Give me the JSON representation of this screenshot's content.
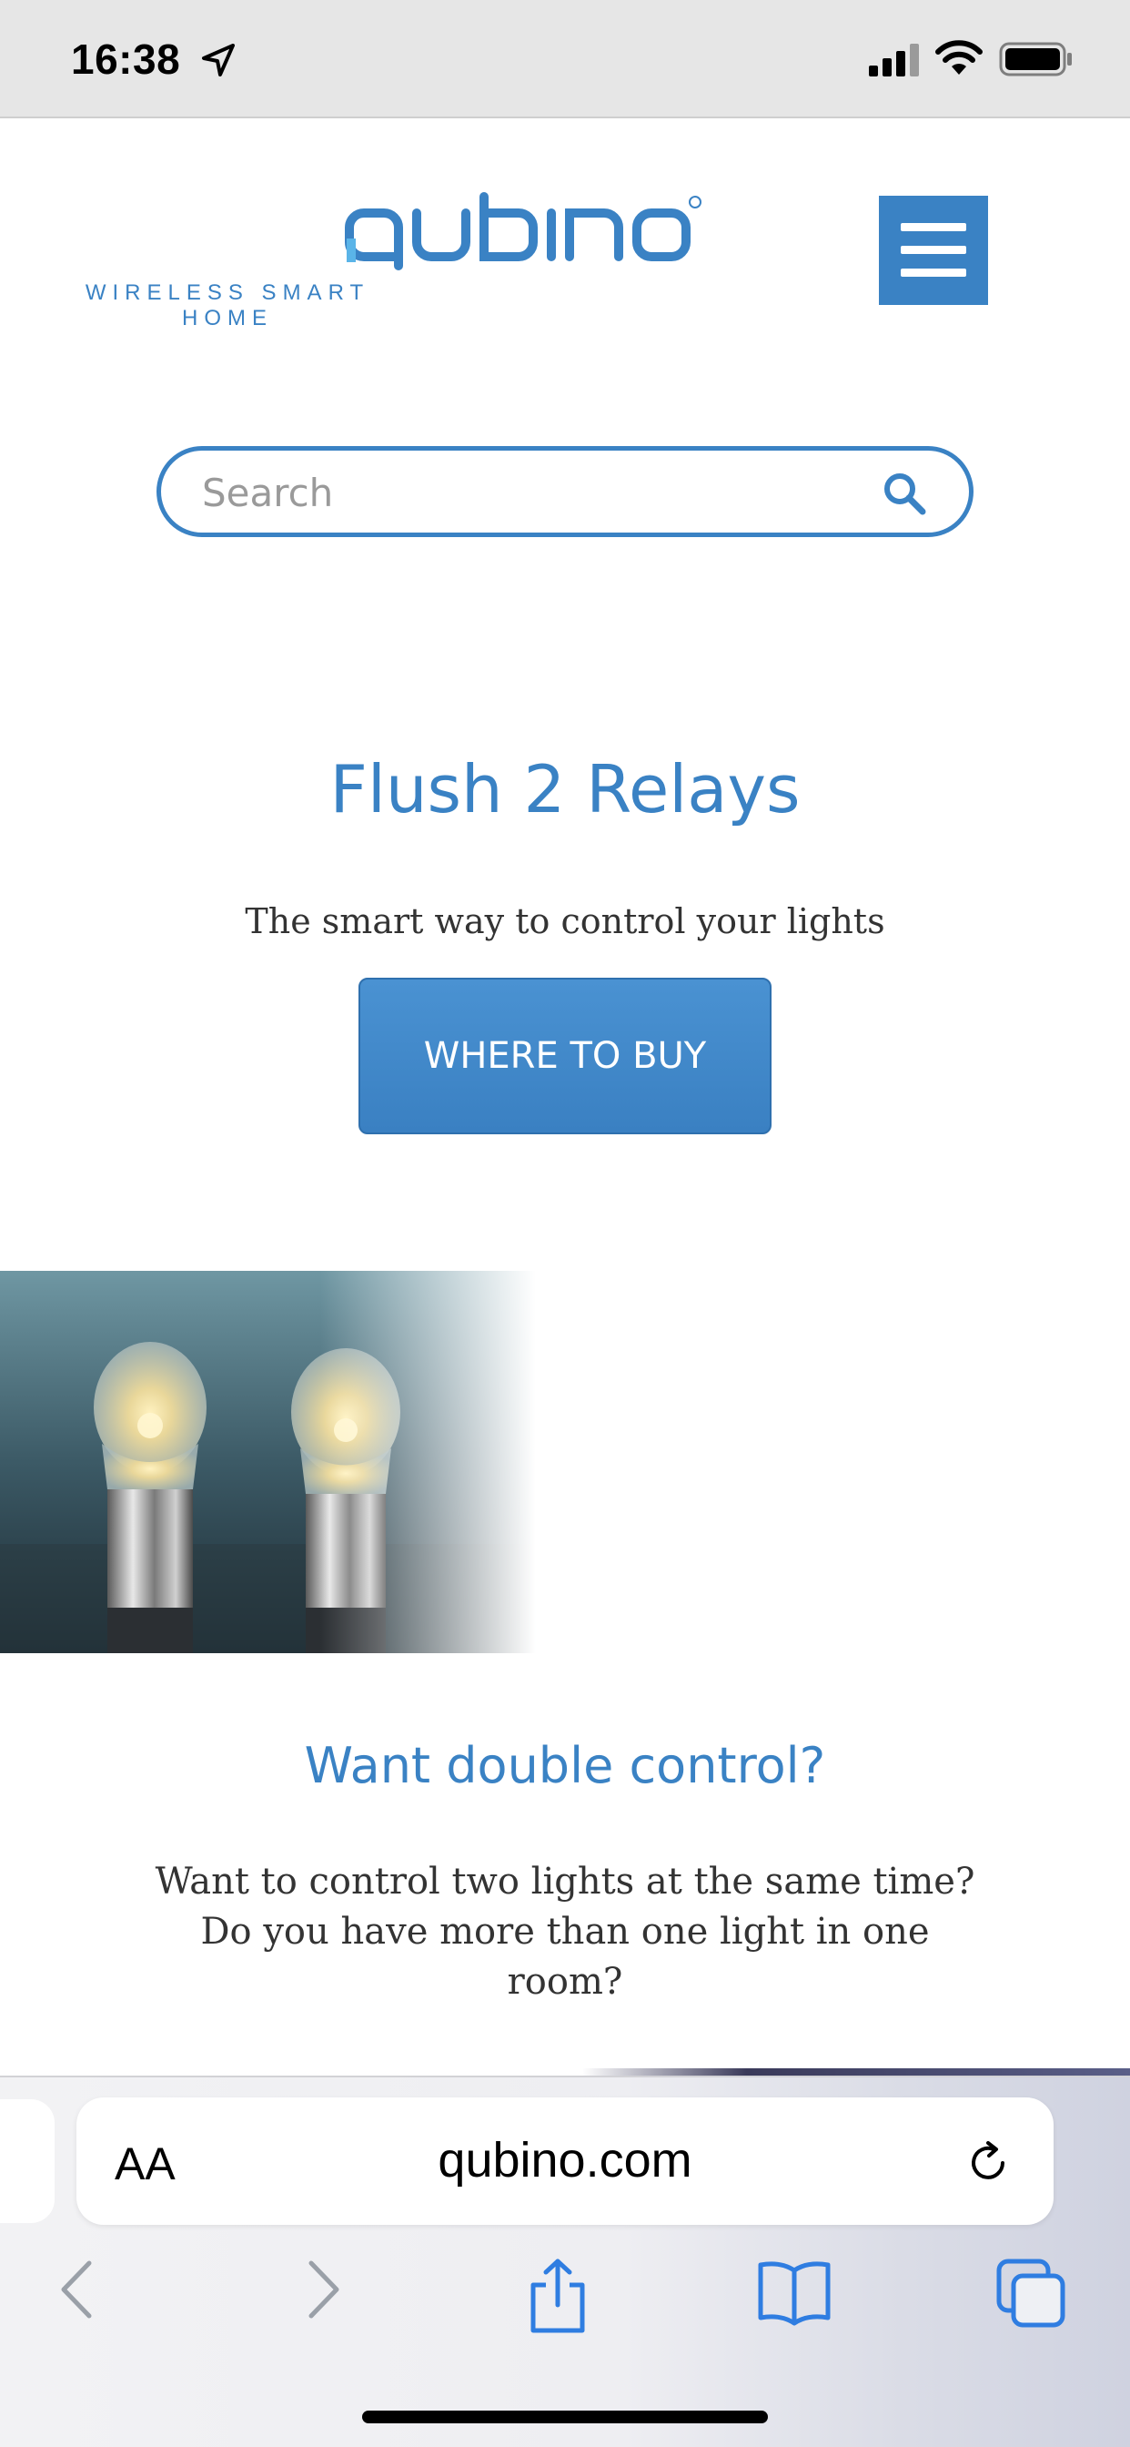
{
  "status_bar": {
    "time": "16:38",
    "icons": [
      "location-arrow-icon",
      "cellular-signal-icon",
      "wifi-icon",
      "battery-icon"
    ]
  },
  "header": {
    "logo_text": "qubino",
    "logo_tagline": "WIRELESS SMART HOME",
    "menu_icon": "hamburger-menu-icon"
  },
  "search": {
    "placeholder": "Search",
    "value": "",
    "icon": "search-icon"
  },
  "hero": {
    "title": "Flush 2 Relays",
    "subtitle": "The smart way to control your lights",
    "cta_label": "WHERE TO BUY"
  },
  "section": {
    "title": "Want double control?",
    "body": "Want to control two lights at the same time? Do you have more than one light in one room?"
  },
  "browser": {
    "text_size_label": "AA",
    "url": "qubino.com",
    "toolbar_icons": [
      "back-icon",
      "forward-icon",
      "share-icon",
      "bookmarks-icon",
      "tabs-icon"
    ]
  },
  "colors": {
    "brand_blue": "#3a82c4",
    "status_bar_bg": "#e6e6e6"
  }
}
